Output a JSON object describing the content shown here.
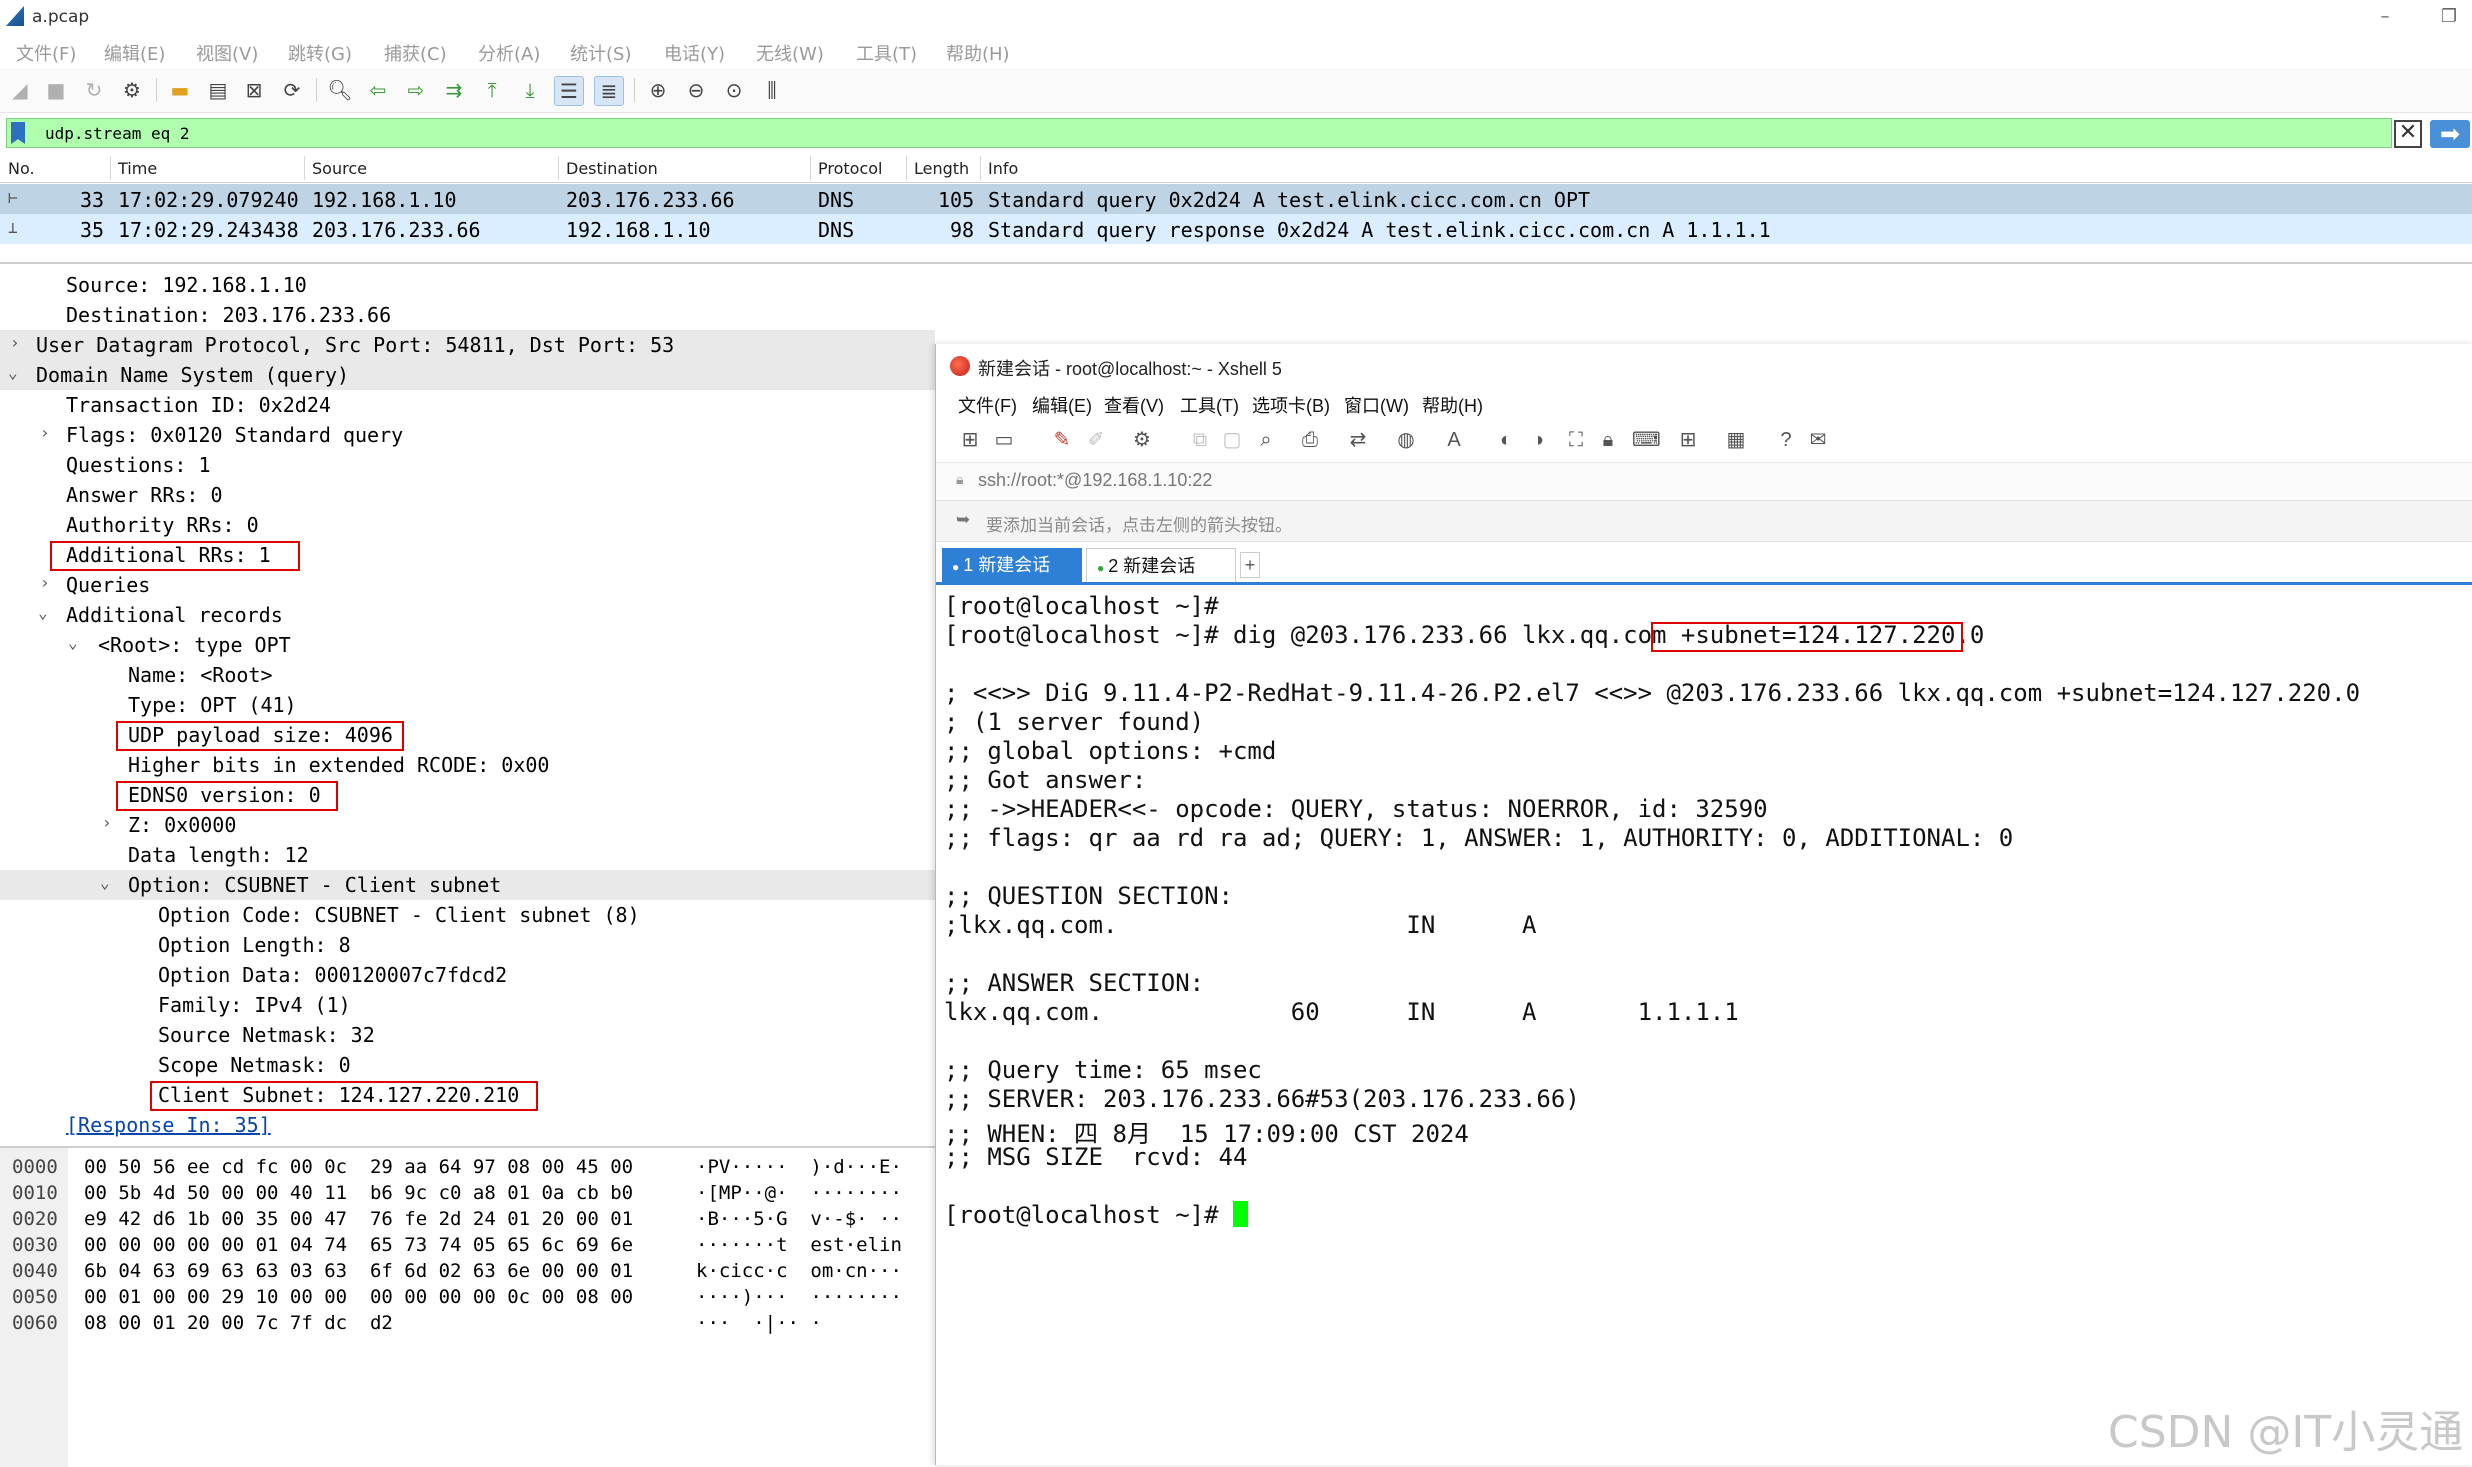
{
  "wireshark": {
    "title": "a.pcap",
    "menu": [
      "文件(F)",
      "编辑(E)",
      "视图(V)",
      "跳转(G)",
      "捕获(C)",
      "分析(A)",
      "统计(S)",
      "电话(Y)",
      "无线(W)",
      "工具(T)",
      "帮助(H)"
    ],
    "filter": "udp.stream eq 2",
    "columns": {
      "no": "No.",
      "time": "Time",
      "source": "Source",
      "destination": "Destination",
      "protocol": "Protocol",
      "length": "Length",
      "info": "Info"
    },
    "packets": [
      {
        "no": "33",
        "time": "17:02:29.079240",
        "source": "192.168.1.10",
        "destination": "203.176.233.66",
        "protocol": "DNS",
        "length": "105",
        "info": "Standard query 0x2d24 A test.elink.cicc.com.cn OPT"
      },
      {
        "no": "35",
        "time": "17:02:29.243438",
        "source": "203.176.233.66",
        "destination": "192.168.1.10",
        "protocol": "DNS",
        "length": "98",
        "info": "Standard query response 0x2d24 A test.elink.cicc.com.cn A 1.1.1.1"
      }
    ],
    "details": [
      {
        "text": "Source: 192.168.1.10"
      },
      {
        "text": "Destination: 203.176.233.66"
      },
      {
        "text": "User Datagram Protocol, Src Port: 54811, Dst Port: 53"
      },
      {
        "text": "Domain Name System (query)"
      },
      {
        "text": "Transaction ID: 0x2d24"
      },
      {
        "text": "Flags: 0x0120 Standard query"
      },
      {
        "text": "Questions: 1"
      },
      {
        "text": "Answer RRs: 0"
      },
      {
        "text": "Authority RRs: 0"
      },
      {
        "text": "Additional RRs: 1"
      },
      {
        "text": "Queries"
      },
      {
        "text": "Additional records"
      },
      {
        "text": "<Root>: type OPT"
      },
      {
        "text": "Name: <Root>"
      },
      {
        "text": "Type: OPT (41)"
      },
      {
        "text": "UDP payload size: 4096"
      },
      {
        "text": "Higher bits in extended RCODE: 0x00"
      },
      {
        "text": "EDNS0 version: 0"
      },
      {
        "text": "Z: 0x0000"
      },
      {
        "text": "Data length: 12"
      },
      {
        "text": "Option: CSUBNET - Client subnet"
      },
      {
        "text": "Option Code: CSUBNET - Client subnet (8)"
      },
      {
        "text": "Option Length: 8"
      },
      {
        "text": "Option Data: 000120007c7fdcd2"
      },
      {
        "text": "Family: IPv4 (1)"
      },
      {
        "text": "Source Netmask: 32"
      },
      {
        "text": "Scope Netmask: 0"
      },
      {
        "text": "Client Subnet: 124.127.220.210"
      },
      {
        "text": "[Response In: 35]"
      }
    ],
    "bytes": [
      {
        "offset": "0000",
        "hex": "00 50 56 ee cd fc 00 0c  29 aa 64 97 08 00 45 00",
        "ascii": "·PV·····  )·d···E·"
      },
      {
        "offset": "0010",
        "hex": "00 5b 4d 50 00 00 40 11  b6 9c c0 a8 01 0a cb b0",
        "ascii": "·[MP··@·  ········"
      },
      {
        "offset": "0020",
        "hex": "e9 42 d6 1b 00 35 00 47  76 fe 2d 24 01 20 00 01",
        "ascii": "·B···5·G  v·-$· ··"
      },
      {
        "offset": "0030",
        "hex": "00 00 00 00 00 01 04 74  65 73 74 05 65 6c 69 6e",
        "ascii": "·······t  est·elin"
      },
      {
        "offset": "0040",
        "hex": "6b 04 63 69 63 63 03 63  6f 6d 02 63 6e 00 00 01",
        "ascii": "k·cicc·c  om·cn···"
      },
      {
        "offset": "0050",
        "hex": "00 01 00 00 29 10 00 00  00 00 00 00 0c 00 08 00",
        "ascii": "····)···  ········"
      },
      {
        "offset": "0060",
        "hex": "08 00 01 20 00 7c 7f dc  d2",
        "ascii": "···  ·|·· ·"
      }
    ]
  },
  "xshell": {
    "title": "新建会话 - root@localhost:~ - Xshell 5",
    "menu": [
      "文件(F)",
      "编辑(E)",
      "查看(V)",
      "工具(T)",
      "选项卡(B)",
      "窗口(W)",
      "帮助(H)"
    ],
    "address": "ssh://root:*@192.168.1.10:22",
    "notice": "要添加当前会话，点击左侧的箭头按钮。",
    "tabs": [
      {
        "label": "1 新建会话"
      },
      {
        "label": "2 新建会话"
      }
    ],
    "tab_add": "+",
    "terminal": [
      "[root@localhost ~]#",
      "[root@localhost ~]# dig @203.176.233.66 lkx.qq.com +subnet=124.127.220.0",
      "",
      "; <<>> DiG 9.11.4-P2-RedHat-9.11.4-26.P2.el7 <<>> @203.176.233.66 lkx.qq.com +subnet=124.127.220.0",
      "; (1 server found)",
      ";; global options: +cmd",
      ";; Got answer:",
      ";; ->>HEADER<<- opcode: QUERY, status: NOERROR, id: 32590",
      ";; flags: qr aa rd ra ad; QUERY: 1, ANSWER: 1, AUTHORITY: 0, ADDITIONAL: 0",
      "",
      ";; QUESTION SECTION:",
      ";lkx.qq.com.                    IN      A",
      "",
      ";; ANSWER SECTION:",
      "lkx.qq.com.             60      IN      A       1.1.1.1",
      "",
      ";; Query time: 65 msec",
      ";; SERVER: 203.176.233.66#53(203.176.233.66)",
      ";; WHEN: 四 8月  15 17:09:00 CST 2024",
      ";; MSG SIZE  rcvd: 44",
      "",
      "[root@localhost ~]# "
    ]
  },
  "watermark": "CSDN @IT小灵通"
}
